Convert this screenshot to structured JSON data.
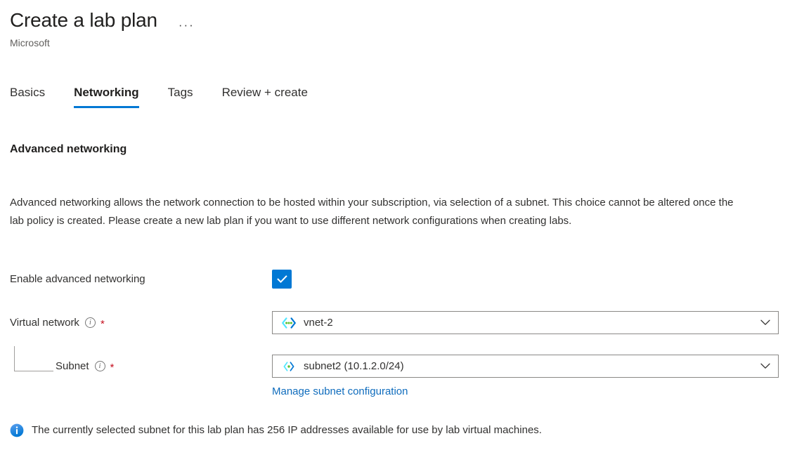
{
  "header": {
    "title": "Create a lab plan",
    "publisher": "Microsoft",
    "more_menu": "···"
  },
  "tabs": [
    {
      "label": "Basics",
      "active": false
    },
    {
      "label": "Networking",
      "active": true
    },
    {
      "label": "Tags",
      "active": false
    },
    {
      "label": "Review + create",
      "active": false
    }
  ],
  "section": {
    "title": "Advanced networking",
    "description": "Advanced networking allows the network connection to be hosted within your subscription, via selection of a subnet. This choice cannot be altered once the lab policy is created. Please create a new lab plan if you want to use different network configurations when creating labs."
  },
  "form": {
    "enable_advanced_networking": {
      "label": "Enable advanced networking",
      "checked": true,
      "icon": "checkmark-icon"
    },
    "virtual_network": {
      "label": "Virtual network",
      "required_marker": "*",
      "info_marker": "i",
      "value": "vnet-2",
      "icon": "virtual-network-icon",
      "chevron": "chevron-down-icon"
    },
    "subnet": {
      "label": "Subnet",
      "required_marker": "*",
      "info_marker": "i",
      "value": "subnet2 (10.1.2.0/24)",
      "icon": "subnet-icon",
      "chevron": "chevron-down-icon"
    },
    "manage_subnet_link": "Manage subnet configuration"
  },
  "info_banner": {
    "icon": "info-circle-icon",
    "text": "The currently selected subnet for this lab plan has 256 IP addresses available for use by lab virtual machines."
  },
  "colors": {
    "accent": "#0078d4",
    "link": "#0f6cbd",
    "required": "#c50f1f",
    "text": "#323130",
    "subtle_text": "#605e5c",
    "border": "#8a8886",
    "vnet_icon_blue": "#0078d4",
    "vnet_icon_cyan": "#50e6ff",
    "vnet_icon_green": "#5ec234"
  }
}
